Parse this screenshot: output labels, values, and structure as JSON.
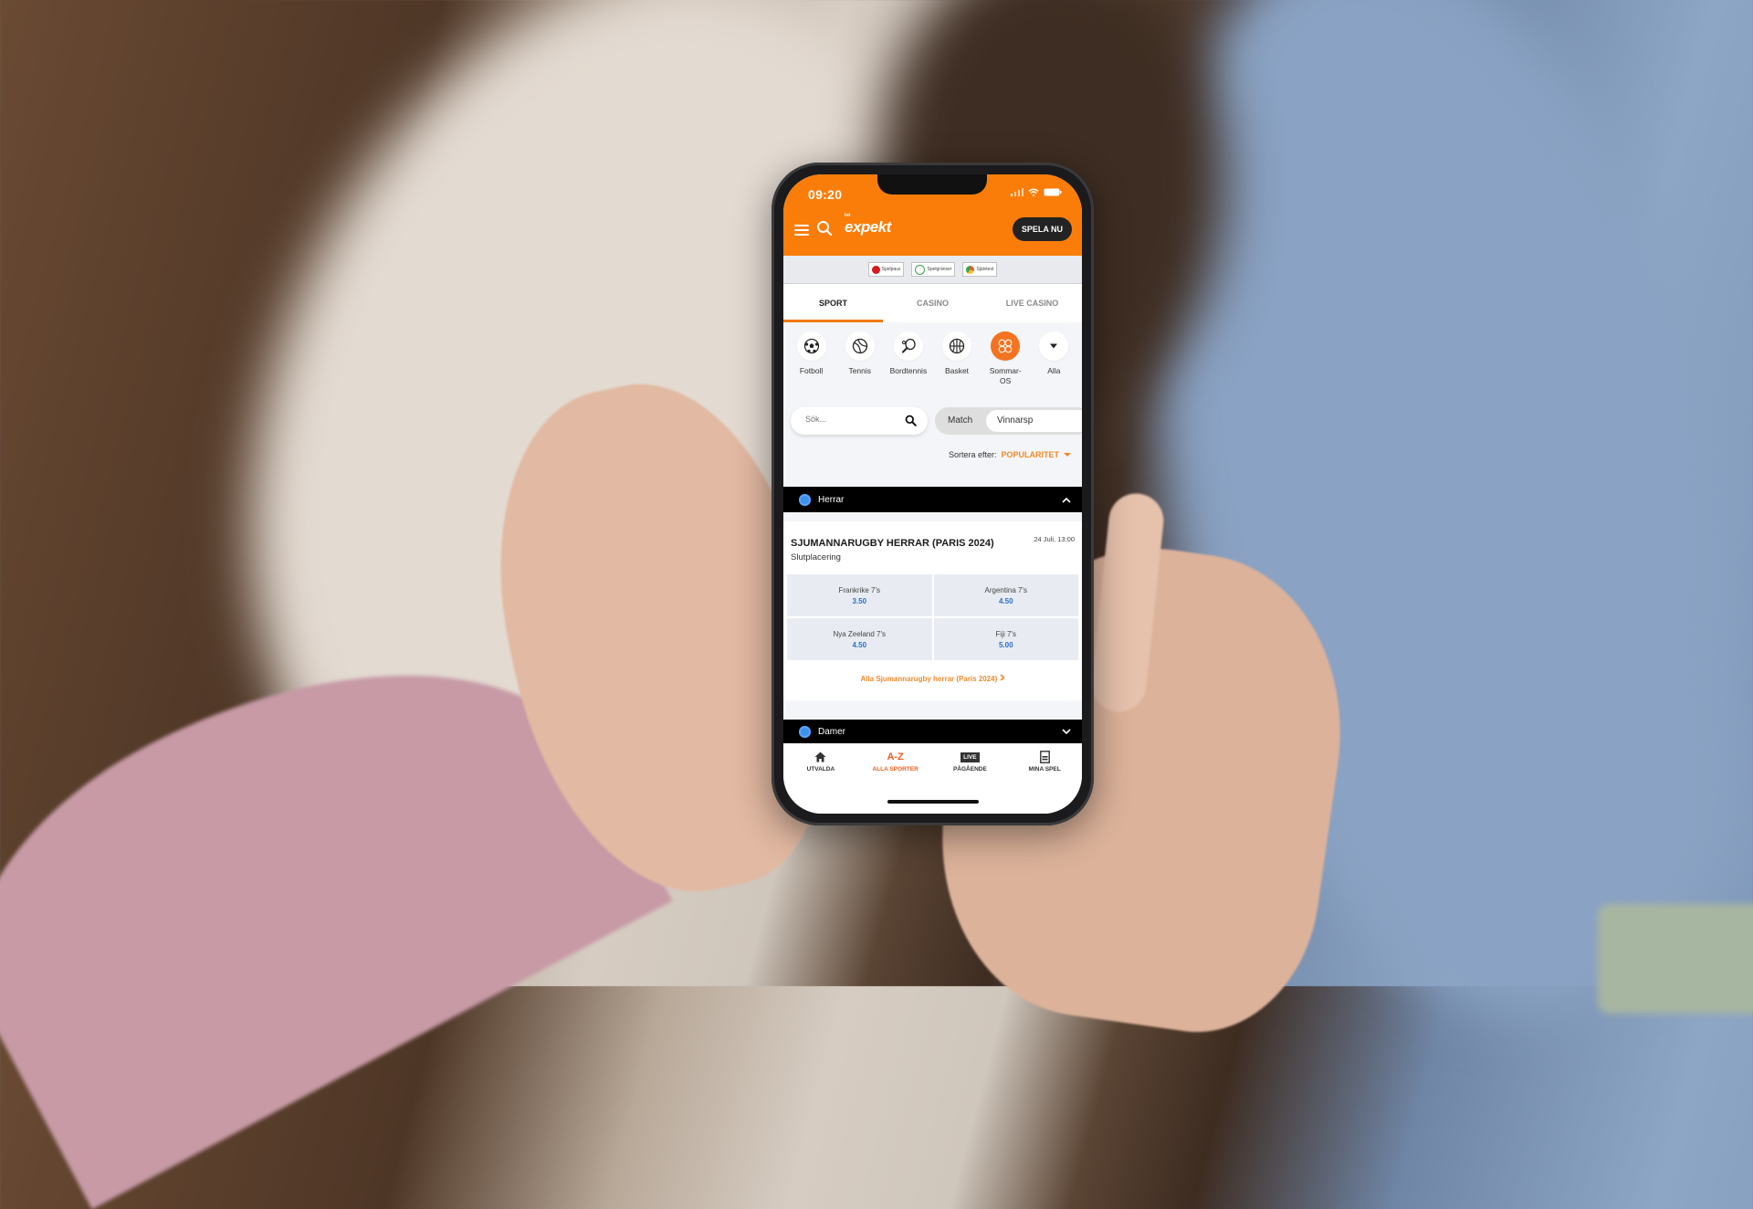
{
  "phone": {
    "status_bar": {
      "time": "09:20"
    },
    "header": {
      "logo": "expekt",
      "logo_prefix": "bet",
      "cta_label": "SPELA NU"
    },
    "responsible_badges": [
      {
        "label": "Spelpaus",
        "icon": "pause-icon",
        "color": "#d71920"
      },
      {
        "label": "Spelgränser",
        "icon": "limits-icon",
        "color": "#3aa04a"
      },
      {
        "label": "Självtest",
        "icon": "gauge-icon",
        "color": "#f2b31b"
      }
    ],
    "tabs": [
      {
        "label": "SPORT",
        "active": true
      },
      {
        "label": "CASINO",
        "active": false
      },
      {
        "label": "LIVE CASINO",
        "active": false
      }
    ],
    "sports": [
      {
        "label": "Fotboll",
        "icon": "soccer-ball-icon",
        "active": false
      },
      {
        "label": "Tennis",
        "icon": "tennis-ball-icon",
        "active": false
      },
      {
        "label": "Bordtennis",
        "icon": "ping-pong-icon",
        "active": false
      },
      {
        "label": "Basket",
        "icon": "basketball-icon",
        "active": false
      },
      {
        "label": "Sommar-OS",
        "label_line1": "Sommar-",
        "label_line2": "OS",
        "icon": "olympics-icon",
        "active": true
      },
      {
        "label": "Alla",
        "icon": "caret-down-icon",
        "active": false
      }
    ],
    "search": {
      "placeholder": "Sök..."
    },
    "segment": {
      "options": [
        "Match",
        "Vinnarsp"
      ],
      "selected": "Vinnarsp"
    },
    "sort": {
      "label": "Sortera efter:",
      "value": "POPULARITET"
    },
    "groups": [
      {
        "name": "Herrar",
        "expanded": true,
        "event": {
          "title": "SJUMANNARUGBY HERRAR (PARIS 2024)",
          "date": "24 Juli, 13:00",
          "market": "Slutplacering",
          "outcomes": [
            {
              "name": "Frankrike 7's",
              "odds": "3.50"
            },
            {
              "name": "Argentina 7's",
              "odds": "4.50"
            },
            {
              "name": "Nya Zeeland 7's",
              "odds": "4.50"
            },
            {
              "name": "Fiji 7's",
              "odds": "5.00"
            }
          ],
          "more_link": "Alla Sjumannarugby herrar (Paris 2024)"
        }
      },
      {
        "name": "Damer",
        "expanded": false
      }
    ],
    "bottom_nav": [
      {
        "label": "UTVALDA",
        "icon": "home-icon",
        "active": false
      },
      {
        "label": "ALLA SPORTER",
        "icon_text": "A-Z",
        "icon": "a-z-icon",
        "active": true
      },
      {
        "label": "PÅGÅENDE",
        "icon_text": "LIVE",
        "icon": "live-icon",
        "active": false
      },
      {
        "label": "MINA SPEL",
        "icon": "betslip-icon",
        "active": false
      }
    ],
    "colors": {
      "brand_orange": "#fb7d09",
      "odds_blue": "#2a6fc9",
      "link_orange": "#ef8a2b",
      "active_nav": "#ef5b1a"
    }
  }
}
